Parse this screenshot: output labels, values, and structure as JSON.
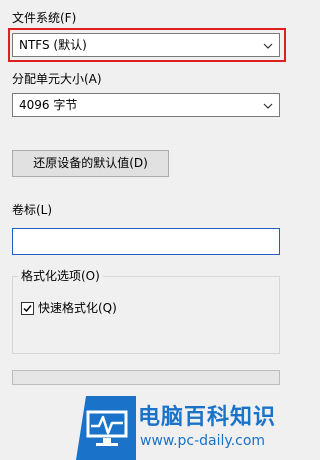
{
  "filesystem": {
    "label": "文件系统(F)",
    "selected": "NTFS (默认)"
  },
  "allocation": {
    "label": "分配单元大小(A)",
    "selected": "4096 字节"
  },
  "restore_button": {
    "label": "还原设备的默认值(D)"
  },
  "volume": {
    "label": "卷标(L)",
    "value": ""
  },
  "format_options": {
    "title": "格式化选项(O)",
    "quick_format": {
      "label": "快速格式化(Q)",
      "checked": true
    }
  },
  "progress": {
    "fraction": 0
  },
  "watermark": {
    "title": "电脑百科知识",
    "url": "www.pc-daily.com",
    "icon": "monitor-pulse-icon"
  },
  "colors": {
    "highlight": "#e0201f",
    "watermark_blue": "#1a73c9"
  }
}
